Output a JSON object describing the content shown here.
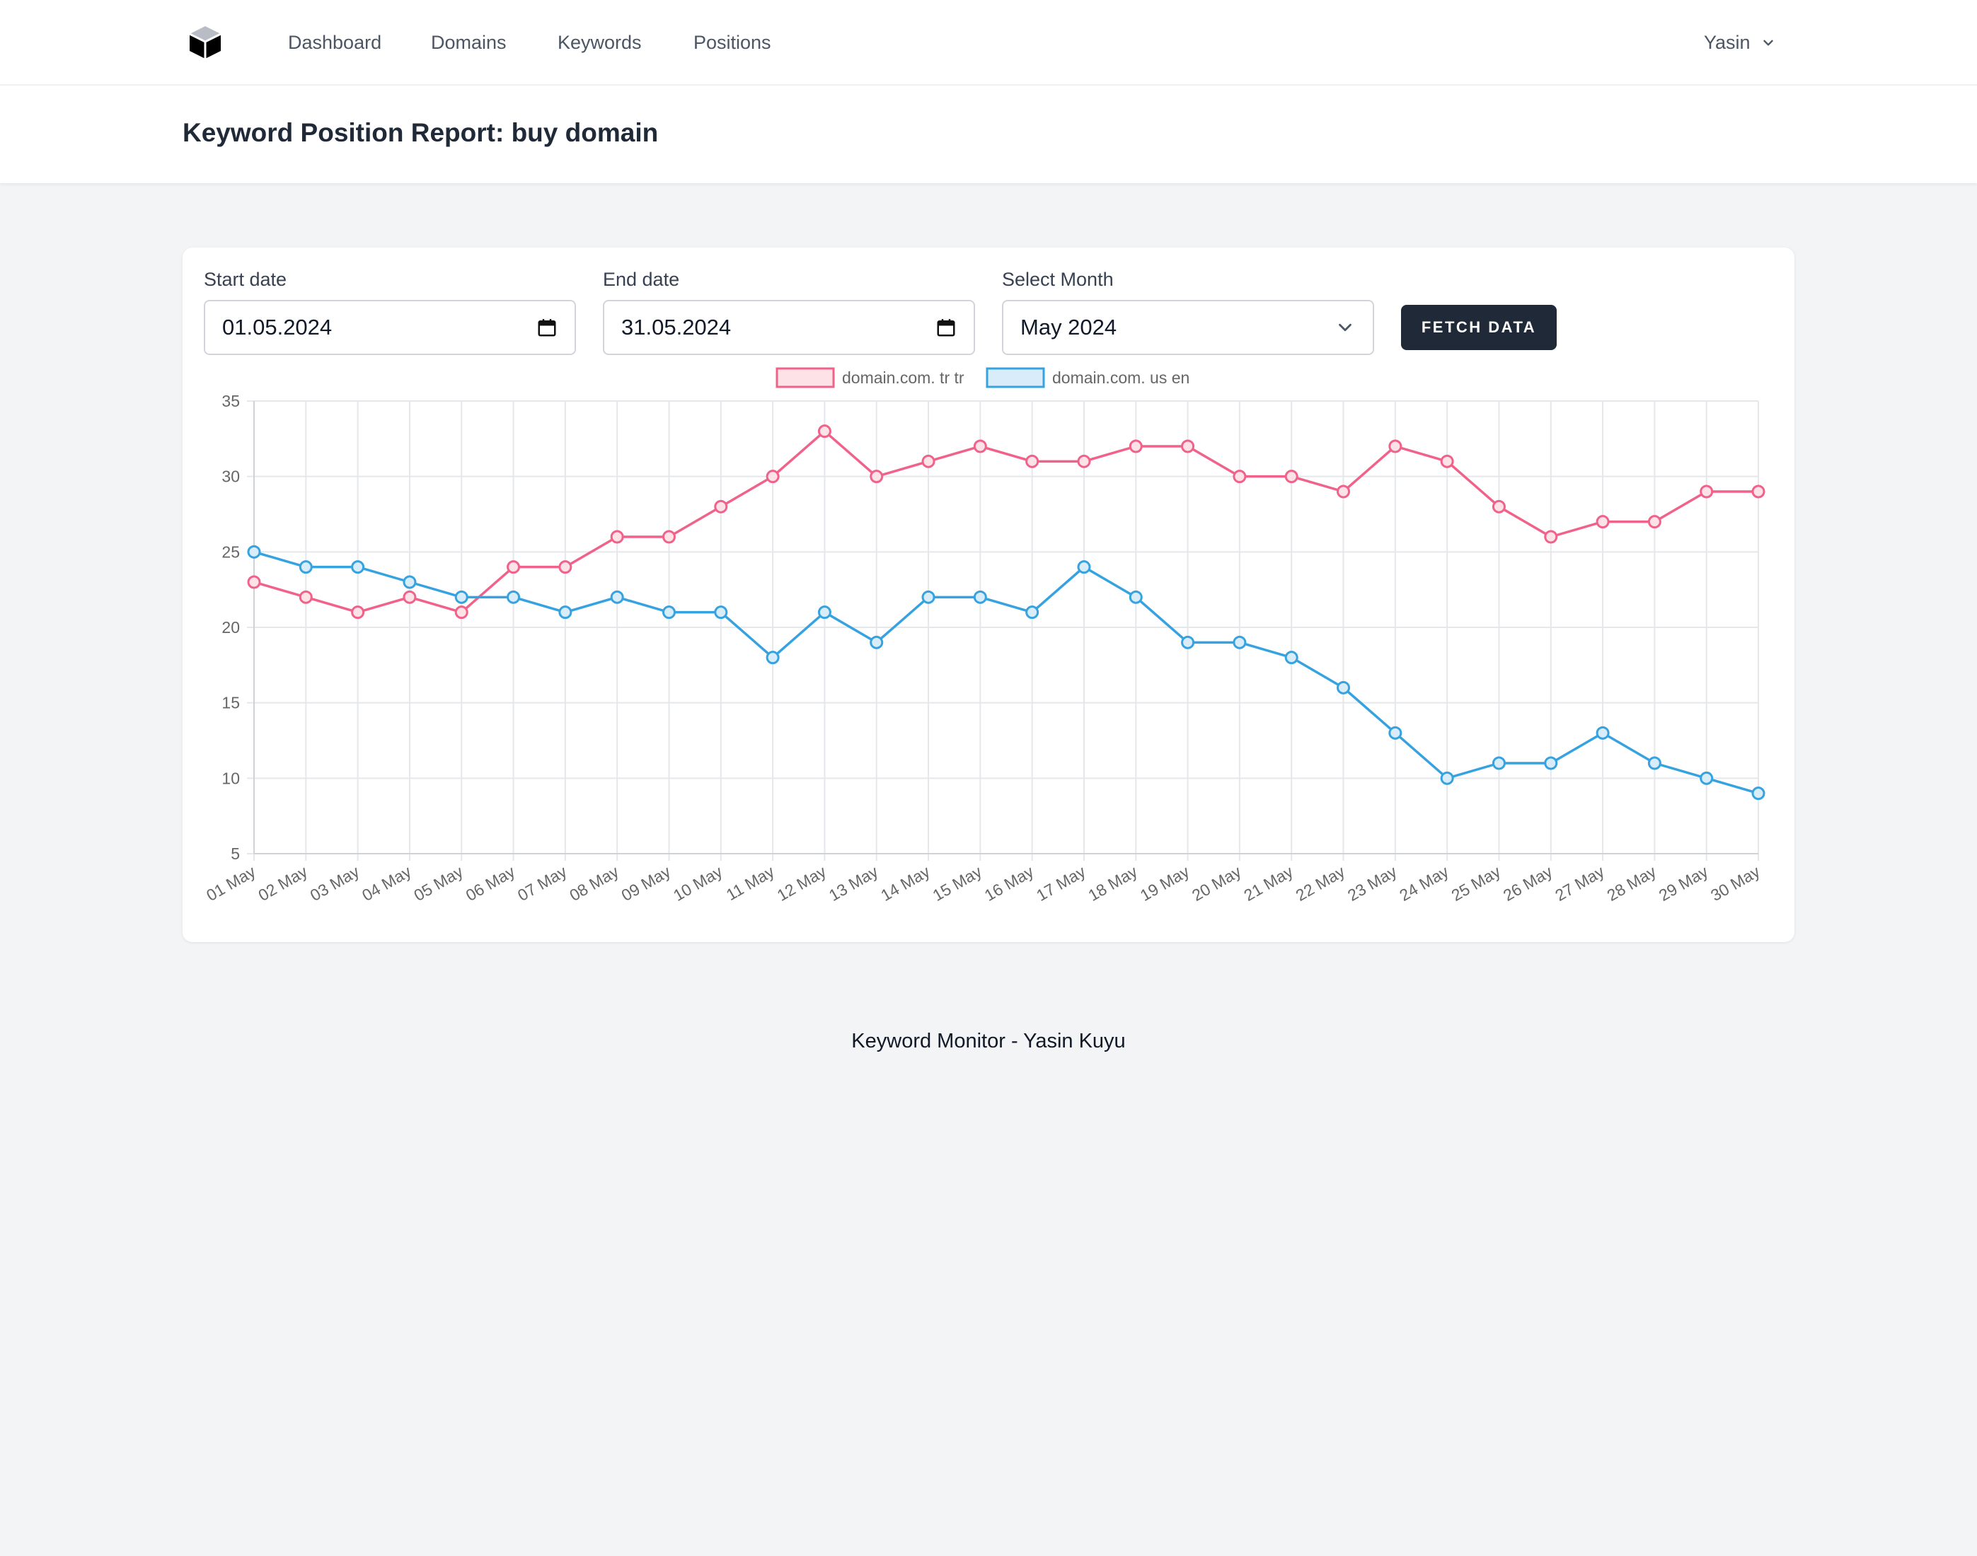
{
  "nav": {
    "links": [
      "Dashboard",
      "Domains",
      "Keywords",
      "Positions"
    ],
    "user": "Yasin"
  },
  "header": {
    "title": "Keyword Position Report: buy domain"
  },
  "filters": {
    "start_label": "Start date",
    "start_value": "01.05.2024",
    "end_label": "End date",
    "end_value": "31.05.2024",
    "month_label": "Select Month",
    "month_value": "May 2024",
    "fetch_label": "FETCH DATA"
  },
  "chart_data": {
    "type": "line",
    "x": [
      "01 May",
      "02 May",
      "03 May",
      "04 May",
      "05 May",
      "06 May",
      "07 May",
      "08 May",
      "09 May",
      "10 May",
      "11 May",
      "12 May",
      "13 May",
      "14 May",
      "15 May",
      "16 May",
      "17 May",
      "18 May",
      "19 May",
      "20 May",
      "21 May",
      "22 May",
      "23 May",
      "24 May",
      "25 May",
      "26 May",
      "27 May",
      "28 May",
      "29 May",
      "30 May"
    ],
    "series": [
      {
        "name": "domain.com. tr tr",
        "color": "#f0628a",
        "fill": "#fde2e8",
        "values": [
          23,
          22,
          21,
          22,
          21,
          24,
          24,
          26,
          26,
          28,
          30,
          33,
          30,
          31,
          32,
          31,
          31,
          32,
          32,
          30,
          30,
          29,
          32,
          31,
          28,
          26,
          27,
          27,
          29,
          29
        ]
      },
      {
        "name": "domain.com. us en",
        "color": "#36a2e0",
        "fill": "#d9ecf9",
        "values": [
          25,
          24,
          24,
          23,
          22,
          22,
          21,
          22,
          21,
          21,
          18,
          21,
          19,
          22,
          22,
          21,
          24,
          22,
          19,
          19,
          18,
          16,
          13,
          10,
          11,
          11,
          13,
          11,
          10,
          9
        ]
      }
    ],
    "ylim": [
      5,
      35
    ],
    "yticks": [
      5,
      10,
      15,
      20,
      25,
      30,
      35
    ],
    "grid": true,
    "legend": "top-center"
  },
  "footer": {
    "text": "Keyword Monitor - Yasin Kuyu"
  }
}
